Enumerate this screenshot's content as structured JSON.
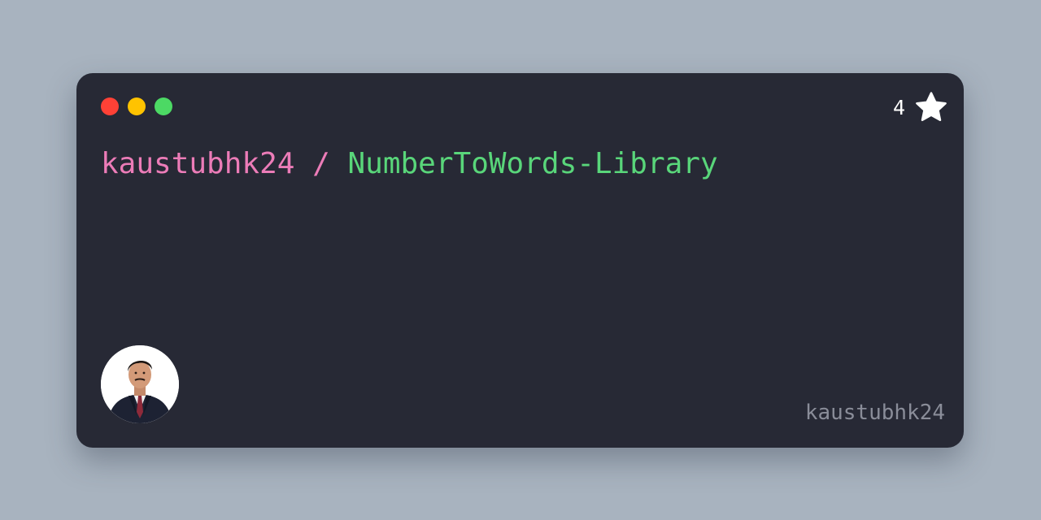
{
  "colors": {
    "page_background": "#a8b3bf",
    "card_background": "#272935",
    "owner_color": "#ec7cb8",
    "repo_color": "#59d67a",
    "username_color": "#8a8d99",
    "dot_red": "#ff4136",
    "dot_yellow": "#ffc300",
    "dot_green": "#4cd964"
  },
  "window_controls": {
    "icons": [
      "close-dot",
      "minimize-dot",
      "maximize-dot"
    ]
  },
  "stars": {
    "count": "4",
    "icon": "star-icon"
  },
  "repo": {
    "owner": "kaustubhk24",
    "separator": "/",
    "name": "NumberToWords-Library"
  },
  "footer": {
    "avatar_icon": "user-avatar",
    "username": "kaustubhk24"
  }
}
